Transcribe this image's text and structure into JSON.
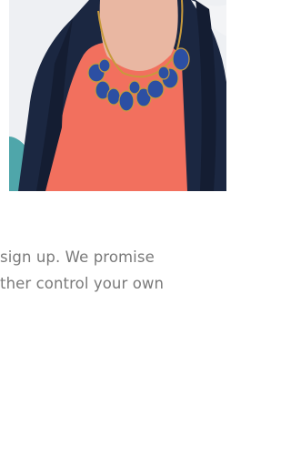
{
  "hero": {
    "image_icon": "woman-portrait-photo"
  },
  "body_text": {
    "line1": "sign up.  We promise",
    "line2": "ther control your own"
  },
  "colors": {
    "background": "#ffffff",
    "text": "#7a7a7a",
    "blazer": "#1d2b45",
    "top": "#f2705e",
    "necklace": "#2c4fa3",
    "chair": "#5fb3b5"
  }
}
